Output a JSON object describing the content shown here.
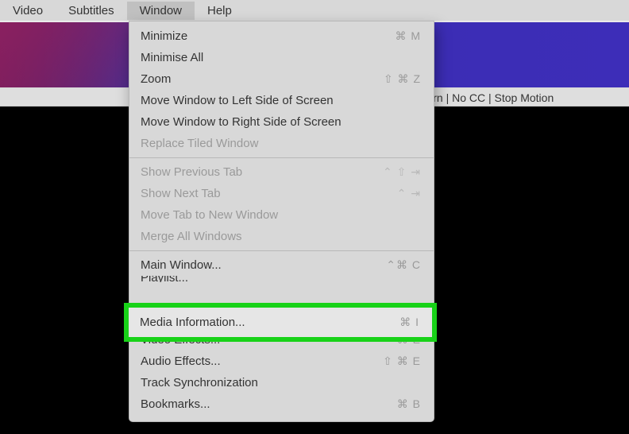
{
  "menubar": {
    "items": [
      {
        "label": "Video",
        "selected": false
      },
      {
        "label": "Subtitles",
        "selected": false
      },
      {
        "label": "Window",
        "selected": true
      },
      {
        "label": "Help",
        "selected": false
      }
    ]
  },
  "titlebar": {
    "text": "ury Barn | No CC | Stop Motion"
  },
  "dropdown": {
    "groups": [
      [
        {
          "label": "Minimize",
          "shortcut": "⌘ M",
          "disabled": false
        },
        {
          "label": "Minimise All",
          "shortcut": "",
          "disabled": false
        },
        {
          "label": "Zoom",
          "shortcut": "⇧ ⌘ Z",
          "disabled": false
        },
        {
          "label": "Move Window to Left Side of Screen",
          "shortcut": "",
          "disabled": false
        },
        {
          "label": "Move Window to Right Side of Screen",
          "shortcut": "",
          "disabled": false
        },
        {
          "label": "Replace Tiled Window",
          "shortcut": "",
          "disabled": true
        }
      ],
      [
        {
          "label": "Show Previous Tab",
          "shortcut": "⌃ ⇧ ⇥",
          "disabled": true
        },
        {
          "label": "Show Next Tab",
          "shortcut": "⌃ ⇥",
          "disabled": true
        },
        {
          "label": "Move Tab to New Window",
          "shortcut": "",
          "disabled": true
        },
        {
          "label": "Merge All Windows",
          "shortcut": "",
          "disabled": true
        }
      ],
      [
        {
          "label": "Main Window...",
          "shortcut": "⌃⌘ C",
          "disabled": false
        },
        {
          "label": "Playlist...",
          "shortcut": "",
          "disabled": false
        },
        {
          "label": "Media Information...",
          "shortcut": "⌘ I",
          "disabled": false,
          "highlighted": true
        }
      ],
      [
        {
          "label": "Video Effects...",
          "shortcut": "⌘ E",
          "disabled": false
        },
        {
          "label": "Audio Effects...",
          "shortcut": "⇧ ⌘ E",
          "disabled": false
        },
        {
          "label": "Track Synchronization",
          "shortcut": "",
          "disabled": false
        },
        {
          "label": "Bookmarks...",
          "shortcut": "⌘ B",
          "disabled": false
        }
      ]
    ]
  },
  "highlight": {
    "label": "Media Information...",
    "shortcut": "⌘ I"
  }
}
